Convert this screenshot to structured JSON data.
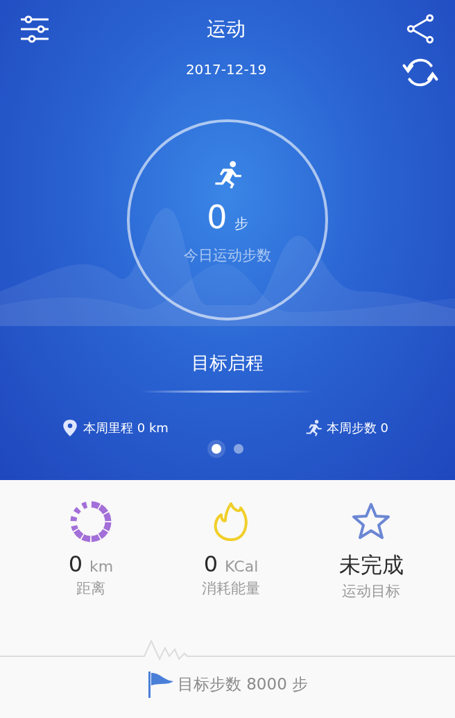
{
  "header": {
    "title": "运动",
    "date": "2017-12-19"
  },
  "today": {
    "steps": "0",
    "unit": "步",
    "label": "今日运动步数"
  },
  "goal_start": "目标启程",
  "weekly": [
    {
      "kind": "distance",
      "text": "本周里程 0 km"
    },
    {
      "kind": "steps",
      "text": "本周步数 0"
    }
  ],
  "pages": [
    {
      "selected": true
    },
    {
      "selected": false
    }
  ],
  "stats": [
    {
      "kind": "distance",
      "value": "0",
      "unit": "km",
      "label": "距离"
    },
    {
      "kind": "calories",
      "value": "0",
      "unit": "KCal",
      "label": "消耗能量"
    },
    {
      "kind": "goal",
      "value": "未完成",
      "label": "运动目标"
    }
  ],
  "target": {
    "text": "目标步数 8000 步"
  }
}
